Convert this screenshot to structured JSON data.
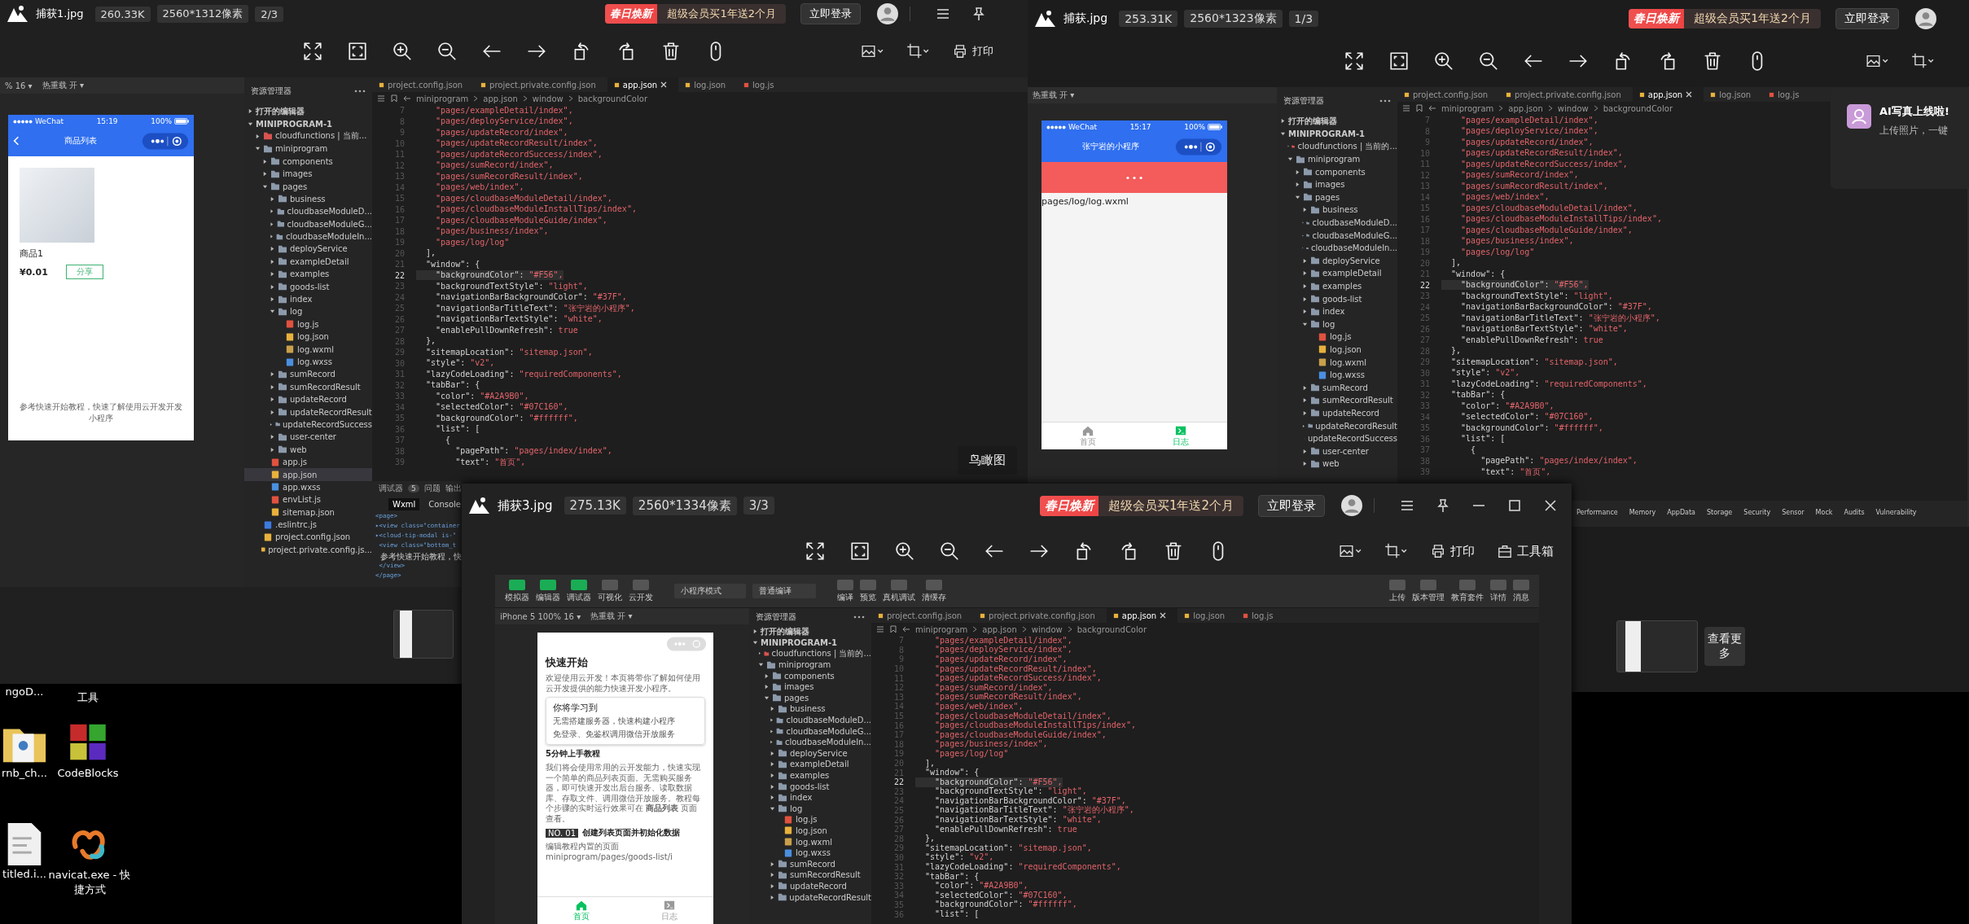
{
  "windows": [
    {
      "file_name": "捕获1.jpg",
      "file_size": "260.33K",
      "dimensions": "2560*1312像素",
      "position": "2/3",
      "promo_tag": "春日焕新",
      "promo_text": "超级会员买1年送2个月",
      "login_button": "立即登录",
      "tools_right": [
        {
          "kind": "image-edit"
        },
        {
          "kind": "crop"
        },
        {
          "kind": "print",
          "label": "打印"
        }
      ],
      "overlay_label": "鸟瞰图",
      "screenshot": {
        "sim_bar": [
          "% 16 ▾",
          "热重载 开 ▾"
        ],
        "phone": {
          "kind": "goods",
          "carrier": "WeChat",
          "time": "15:19",
          "battery": "100%",
          "title": "商品列表",
          "product_name": "商品1",
          "price": "¥0.01",
          "share_button": "分享",
          "footer": "参考快速开始教程，快速了解使用云开发开发小程序"
        },
        "explorer_title": "资源管理器",
        "tree": [
          {
            "label": "打开的编辑器",
            "kind": "section",
            "expanded": false,
            "selected": false
          },
          {
            "label": "MINIPROGRAM-1",
            "kind": "section",
            "expanded": true,
            "selected": false,
            "children": [
              {
                "label": "cloudfunctions | 当前...",
                "kind": "cloud",
                "expanded": false,
                "selected": false
              },
              {
                "label": "miniprogram",
                "kind": "folder",
                "expanded": true,
                "selected": false,
                "children": [
                  {
                    "label": "components",
                    "kind": "folder",
                    "expanded": false,
                    "selected": false
                  },
                  {
                    "label": "images",
                    "kind": "folder",
                    "expanded": false,
                    "selected": false
                  },
                  {
                    "label": "pages",
                    "kind": "folder",
                    "expanded": true,
                    "selected": false,
                    "children": [
                      {
                        "label": "business",
                        "kind": "folder",
                        "expanded": false,
                        "selected": false
                      },
                      {
                        "label": "cloudbaseModuleD...",
                        "kind": "folder",
                        "expanded": false,
                        "selected": false
                      },
                      {
                        "label": "cloudbaseModuleG...",
                        "kind": "folder",
                        "expanded": false,
                        "selected": false
                      },
                      {
                        "label": "cloudbaseModuleIn...",
                        "kind": "folder",
                        "expanded": false,
                        "selected": false
                      },
                      {
                        "label": "deployService",
                        "kind": "folder",
                        "expanded": false,
                        "selected": false
                      },
                      {
                        "label": "exampleDetail",
                        "kind": "folder",
                        "expanded": false,
                        "selected": false
                      },
                      {
                        "label": "examples",
                        "kind": "folder",
                        "expanded": false,
                        "selected": false
                      },
                      {
                        "label": "goods-list",
                        "kind": "folder",
                        "expanded": false,
                        "selected": false
                      },
                      {
                        "label": "index",
                        "kind": "folder",
                        "expanded": false,
                        "selected": false
                      },
                      {
                        "label": "log",
                        "kind": "folder",
                        "expanded": true,
                        "selected": false,
                        "children": [
                          {
                            "label": "log.js",
                            "kind": "js",
                            "selected": false
                          },
                          {
                            "label": "log.json",
                            "kind": "json",
                            "selected": false
                          },
                          {
                            "label": "log.wxml",
                            "kind": "wxml",
                            "selected": false
                          },
                          {
                            "label": "log.wxss",
                            "kind": "wxss",
                            "selected": false
                          }
                        ]
                      },
                      {
                        "label": "sumRecord",
                        "kind": "folder",
                        "expanded": false,
                        "selected": false
                      },
                      {
                        "label": "sumRecordResult",
                        "kind": "folder",
                        "expanded": false,
                        "selected": false
                      },
                      {
                        "label": "updateRecord",
                        "kind": "folder",
                        "expanded": false,
                        "selected": false
                      },
                      {
                        "label": "updateRecordResult",
                        "kind": "folder",
                        "expanded": false,
                        "selected": false
                      },
                      {
                        "label": "updateRecordSuccess",
                        "kind": "folder",
                        "expanded": false,
                        "selected": false
                      },
                      {
                        "label": "user-center",
                        "kind": "folder",
                        "expanded": false,
                        "selected": false
                      },
                      {
                        "label": "web",
                        "kind": "folder",
                        "expanded": false,
                        "selected": false
                      }
                    ]
                  },
                  {
                    "label": "app.js",
                    "kind": "js",
                    "selected": false
                  },
                  {
                    "label": "app.json",
                    "kind": "json",
                    "selected": true
                  },
                  {
                    "label": "app.wxss",
                    "kind": "wxss",
                    "selected": false
                  },
                  {
                    "label": "envList.js",
                    "kind": "js",
                    "selected": false
                  },
                  {
                    "label": "sitemap.json",
                    "kind": "json",
                    "selected": false
                  }
                ]
              },
              {
                "label": ".eslintrc.js",
                "kind": "config",
                "selected": false
              },
              {
                "label": "project.config.json",
                "kind": "json",
                "selected": false
              },
              {
                "label": "project.private.config.js...",
                "kind": "json",
                "selected": false
              }
            ]
          }
        ],
        "tabs": [
          {
            "label": "project.config.json",
            "kind": "json",
            "selected": false
          },
          {
            "label": "project.private.config.json",
            "kind": "json",
            "selected": false
          },
          {
            "label": "app.json",
            "kind": "json",
            "selected": true
          },
          {
            "label": "log.json",
            "kind": "json",
            "selected": false
          },
          {
            "label": "log.js",
            "kind": "js",
            "selected": false
          }
        ],
        "breadcrumb": [
          "miniprogram",
          "app.json",
          "window",
          "backgroundColor"
        ],
        "code": [
          {
            "n": "7",
            "val": "    \"pages/exampleDetail/index\",",
            "current": false
          },
          {
            "n": "8",
            "val": "    \"pages/deployService/index\",",
            "current": false
          },
          {
            "n": "9",
            "val": "    \"pages/updateRecord/index\",",
            "current": false
          },
          {
            "n": "10",
            "val": "    \"pages/updateRecordResult/index\",",
            "current": false
          },
          {
            "n": "11",
            "val": "    \"pages/updateRecordSuccess/index\",",
            "current": false
          },
          {
            "n": "12",
            "val": "    \"pages/sumRecord/index\",",
            "current": false
          },
          {
            "n": "13",
            "val": "    \"pages/sumRecordResult/index\",",
            "current": false
          },
          {
            "n": "14",
            "val": "    \"pages/web/index\",",
            "current": false
          },
          {
            "n": "15",
            "val": "    \"pages/cloudbaseModuleDetail/index\",",
            "current": false
          },
          {
            "n": "16",
            "val": "    \"pages/cloudbaseModuleInstallTips/index\",",
            "current": false
          },
          {
            "n": "17",
            "val": "    \"pages/cloudbaseModuleGuide/index\",",
            "current": false
          },
          {
            "n": "18",
            "val": "    \"pages/business/index\",",
            "current": false
          },
          {
            "n": "19",
            "val": "    \"pages/log/log\"",
            "current": false
          },
          {
            "n": "20",
            "key": "  ],",
            "current": false
          },
          {
            "n": "21",
            "key": "  \"window\": {",
            "current": false
          },
          {
            "n": "22",
            "key": "    \"backgroundColor\": ",
            "val": "\"#F56\",",
            "current": true
          },
          {
            "n": "23",
            "key": "    \"backgroundTextStyle\": ",
            "val": "\"light\",",
            "current": false
          },
          {
            "n": "24",
            "key": "    \"navigationBarBackgroundColor\": ",
            "val": "\"#37F\",",
            "current": false
          },
          {
            "n": "25",
            "key": "    \"navigationBarTitleText\": ",
            "val": "\"张宁岩的小程序\",",
            "current": false
          },
          {
            "n": "26",
            "key": "    \"navigationBarTextStyle\": ",
            "val": "\"white\",",
            "current": false
          },
          {
            "n": "27",
            "key": "    \"enablePullDownRefresh\": ",
            "val": "true",
            "current": false
          },
          {
            "n": "28",
            "key": "  },",
            "current": false
          },
          {
            "n": "29",
            "key": "  \"sitemapLocation\": ",
            "val": "\"sitemap.json\",",
            "current": false
          },
          {
            "n": "30",
            "key": "  \"style\": ",
            "val": "\"v2\",",
            "current": false
          },
          {
            "n": "31",
            "key": "  \"lazyCodeLoading\": ",
            "val": "\"requiredComponents\",",
            "current": false
          },
          {
            "n": "32",
            "key": "  \"tabBar\": {",
            "current": false
          },
          {
            "n": "33",
            "key": "    \"color\": ",
            "val": "\"#A2A9B0\",",
            "current": false
          },
          {
            "n": "34",
            "key": "    \"selectedColor\": ",
            "val": "\"#07C160\",",
            "current": false
          },
          {
            "n": "35",
            "key": "    \"backgroundColor\": ",
            "val": "\"#ffffff\",",
            "current": false
          },
          {
            "n": "36",
            "key": "    \"list\": [",
            "current": false
          },
          {
            "n": "37",
            "key": "      {",
            "current": false
          },
          {
            "n": "38",
            "key": "        \"pagePath\": ",
            "val": "\"pages/index/index\",",
            "current": false
          },
          {
            "n": "39",
            "key": "        \"text\": ",
            "val": "\"首页\",",
            "current": false
          }
        ],
        "debug": {
          "tabs": [
            {
              "label": "调试器",
              "badge": "5"
            },
            {
              "label": "问题"
            },
            {
              "label": "输出"
            }
          ],
          "subtabs": [
            {
              "label": "Wxml",
              "selected": true
            },
            {
              "label": "Console",
              "selected": false
            }
          ],
          "lines": [
            {
              "kind": "tag",
              "text": "<page>"
            },
            {
              "kind": "tag",
              "text": "▸<view class=\"container"
            },
            {
              "kind": "tag",
              "text": "▸<cloud-tip-modal is-\""
            },
            {
              "kind": "tag",
              "text": " <view class=\"bottom_t"
            },
            {
              "kind": "text",
              "text": "  参考快速开始教程，快"
            },
            {
              "kind": "tag",
              "text": " </view>"
            },
            {
              "kind": "tag",
              "text": "</page>"
            }
          ]
        }
      }
    },
    {
      "file_name": "捕获.jpg",
      "file_size": "253.31K",
      "dimensions": "2560*1323像素",
      "position": "1/3",
      "promo_tag": "春日焕新",
      "promo_text": "超级会员买1年送2个月",
      "login_button": "立即登录",
      "tools_right": [
        {
          "kind": "image-edit"
        },
        {
          "kind": "crop"
        }
      ],
      "notification": {
        "title": "AI写真上线啦!",
        "text": "上传照片，一键"
      },
      "more_button": "查看更多",
      "screenshot": {
        "sim_bar": [
          "热重载 开 ▾"
        ],
        "phone": {
          "kind": "log",
          "carrier": "WeChat",
          "time": "15:17",
          "battery": "100%",
          "title": "张宁岩的小程序",
          "page_path": "pages/log/log.wxml",
          "tabbar": [
            {
              "label": "首页",
              "selected": false
            },
            {
              "label": "日志",
              "selected": true
            }
          ]
        },
        "explorer_title": "资源管理器",
        "tree": [
          {
            "label": "打开的编辑器",
            "kind": "section",
            "expanded": false
          },
          {
            "label": "MINIPROGRAM-1",
            "kind": "section",
            "expanded": true,
            "children": [
              {
                "label": "cloudfunctions | 当前的...",
                "kind": "cloud",
                "expanded": false
              },
              {
                "label": "miniprogram",
                "kind": "folder",
                "expanded": true,
                "children": [
                  {
                    "label": "components",
                    "kind": "folder",
                    "expanded": false
                  },
                  {
                    "label": "images",
                    "kind": "folder",
                    "expanded": false
                  },
                  {
                    "label": "pages",
                    "kind": "folder",
                    "expanded": true,
                    "children": [
                      {
                        "label": "business",
                        "kind": "folder",
                        "expanded": false
                      },
                      {
                        "label": "cloudbaseModuleD...",
                        "kind": "folder",
                        "expanded": false
                      },
                      {
                        "label": "cloudbaseModuleG...",
                        "kind": "folder",
                        "expanded": false
                      },
                      {
                        "label": "cloudbaseModuleIn...",
                        "kind": "folder",
                        "expanded": false
                      },
                      {
                        "label": "deployService",
                        "kind": "folder",
                        "expanded": false
                      },
                      {
                        "label": "exampleDetail",
                        "kind": "folder",
                        "expanded": false
                      },
                      {
                        "label": "examples",
                        "kind": "folder",
                        "expanded": false
                      },
                      {
                        "label": "goods-list",
                        "kind": "folder",
                        "expanded": false
                      },
                      {
                        "label": "index",
                        "kind": "folder",
                        "expanded": false
                      },
                      {
                        "label": "log",
                        "kind": "folder",
                        "expanded": true,
                        "children": [
                          {
                            "label": "log.js",
                            "kind": "js"
                          },
                          {
                            "label": "log.json",
                            "kind": "json"
                          },
                          {
                            "label": "log.wxml",
                            "kind": "wxml"
                          },
                          {
                            "label": "log.wxss",
                            "kind": "wxss"
                          }
                        ]
                      },
                      {
                        "label": "sumRecord",
                        "kind": "folder",
                        "expanded": false
                      },
                      {
                        "label": "sumRecordResult",
                        "kind": "folder",
                        "expanded": false
                      },
                      {
                        "label": "updateRecord",
                        "kind": "folder",
                        "expanded": false
                      },
                      {
                        "label": "updateRecordResult",
                        "kind": "folder",
                        "expanded": false
                      },
                      {
                        "label": "updateRecordSuccess",
                        "kind": "folder",
                        "expanded": false
                      },
                      {
                        "label": "user-center",
                        "kind": "folder",
                        "expanded": false
                      },
                      {
                        "label": "web",
                        "kind": "folder",
                        "expanded": false
                      }
                    ]
                  }
                ]
              }
            ]
          }
        ],
        "tabs": [
          {
            "label": "project.config.json",
            "kind": "json",
            "selected": false
          },
          {
            "label": "project.private.config.json",
            "kind": "json",
            "selected": false
          },
          {
            "label": "app.json",
            "kind": "json",
            "selected": true
          },
          {
            "label": "log.json",
            "kind": "json",
            "selected": false
          },
          {
            "label": "log.js",
            "kind": "js",
            "selected": false
          }
        ],
        "breadcrumb": [
          "miniprogram",
          "app.json",
          "window",
          "backgroundColor"
        ],
        "code": [
          {
            "n": "7",
            "val": "    \"pages/exampleDetail/index\",",
            "current": false
          },
          {
            "n": "8",
            "val": "    \"pages/deployService/index\",",
            "current": false
          },
          {
            "n": "9",
            "val": "    \"pages/updateRecord/index\",",
            "current": false
          },
          {
            "n": "10",
            "val": "    \"pages/updateRecordResult/index\",",
            "current": false
          },
          {
            "n": "11",
            "val": "    \"pages/updateRecordSuccess/index\",",
            "current": false
          },
          {
            "n": "12",
            "val": "    \"pages/sumRecord/index\",",
            "current": false
          },
          {
            "n": "13",
            "val": "    \"pages/sumRecordResult/index\",",
            "current": false
          },
          {
            "n": "14",
            "val": "    \"pages/web/index\",",
            "current": false
          },
          {
            "n": "15",
            "val": "    \"pages/cloudbaseModuleDetail/index\",",
            "current": false
          },
          {
            "n": "16",
            "val": "    \"pages/cloudbaseModuleInstallTips/index\",",
            "current": false
          },
          {
            "n": "17",
            "val": "    \"pages/cloudbaseModuleGuide/index\",",
            "current": false
          },
          {
            "n": "18",
            "val": "    \"pages/business/index\",",
            "current": false
          },
          {
            "n": "19",
            "val": "    \"pages/log/log\"",
            "current": false
          },
          {
            "n": "20",
            "key": "  ],",
            "current": false
          },
          {
            "n": "21",
            "key": "  \"window\": {",
            "current": false
          },
          {
            "n": "22",
            "key": "    \"backgroundColor\": ",
            "val": "\"#F56\",",
            "current": true
          },
          {
            "n": "23",
            "key": "    \"backgroundTextStyle\": ",
            "val": "\"light\",",
            "current": false
          },
          {
            "n": "24",
            "key": "    \"navigationBarBackgroundColor\": ",
            "val": "\"#37F\",",
            "current": false
          },
          {
            "n": "25",
            "key": "    \"navigationBarTitleText\": ",
            "val": "\"张宁岩的小程序\",",
            "current": false
          },
          {
            "n": "26",
            "key": "    \"navigationBarTextStyle\": ",
            "val": "\"white\",",
            "current": false
          },
          {
            "n": "27",
            "key": "    \"enablePullDownRefresh\": ",
            "val": "true",
            "current": false
          },
          {
            "n": "28",
            "key": "  },",
            "current": false
          },
          {
            "n": "29",
            "key": "  \"sitemapLocation\": ",
            "val": "\"sitemap.json\",",
            "current": false
          },
          {
            "n": "30",
            "key": "  \"style\": ",
            "val": "\"v2\",",
            "current": false
          },
          {
            "n": "31",
            "key": "  \"lazyCodeLoading\": ",
            "val": "\"requiredComponents\",",
            "current": false
          },
          {
            "n": "32",
            "key": "  \"tabBar\": {",
            "current": false
          },
          {
            "n": "33",
            "key": "    \"color\": ",
            "val": "\"#A2A9B0\",",
            "current": false
          },
          {
            "n": "34",
            "key": "    \"selectedColor\": ",
            "val": "\"#07C160\",",
            "current": false
          },
          {
            "n": "35",
            "key": "    \"backgroundColor\": ",
            "val": "\"#ffffff\",",
            "current": false
          },
          {
            "n": "36",
            "key": "    \"list\": [",
            "current": false
          },
          {
            "n": "37",
            "key": "      {",
            "current": false
          },
          {
            "n": "38",
            "key": "        \"pagePath\": ",
            "val": "\"pages/index/index\",",
            "current": false
          },
          {
            "n": "39",
            "key": "        \"text\": ",
            "val": "\"首页\",",
            "current": false
          }
        ],
        "panel_tabs": [
          "Performance",
          "Memory",
          "AppData",
          "Storage",
          "Security",
          "Sensor",
          "Mock",
          "Audits",
          "Vulnerability"
        ]
      }
    },
    {
      "file_name": "捕获3.jpg",
      "file_size": "275.13K",
      "dimensions": "2560*1334像素",
      "position": "3/3",
      "promo_tag": "春日焕新",
      "promo_text": "超级会员买1年送2个月",
      "login_button": "立即登录",
      "tools_right": [
        {
          "kind": "image-edit"
        },
        {
          "kind": "crop"
        },
        {
          "kind": "print",
          "label": "打印"
        },
        {
          "kind": "toolbox",
          "label": "工具箱"
        }
      ],
      "screenshot": {
        "ide_toolbar": {
          "views": [
            {
              "label": "模拟器",
              "on": true
            },
            {
              "label": "编辑器",
              "on": true
            },
            {
              "label": "调试器",
              "on": true
            },
            {
              "label": "可视化",
              "on": false
            },
            {
              "label": "云开发",
              "on": false
            }
          ],
          "selects": [
            "小程序模式",
            "普通编译"
          ],
          "actions": [
            "编译",
            "预览",
            "真机调试",
            "清缓存"
          ],
          "right": [
            "上传",
            "版本管理",
            "教育套件",
            "详情",
            "消息"
          ]
        },
        "sim_bar": [
          "iPhone 5 100% 16 ▾",
          "热重载 开 ▾"
        ],
        "phone": {
          "kind": "quickstart",
          "heading": "快速开始",
          "intro": "欢迎使用云开发！本页将带你了解如何使用云开发提供的能力快速开发小程序。",
          "card_title": "你将学习到",
          "bullets": [
            "无需搭建服务器，快速构建小程序",
            "免登录、免鉴权调用微信开放服务"
          ],
          "section_title": "5分钟上手教程",
          "paragraph": "我们将会使用常用的云开发能力，快速实现一个简单的商品列表页面。无需购买服务器，即可快速开发出后台服务、读取数据库、存取文件、调用微信开放服务。教程每个步骤的实时运行效果可在 **商品列表** 页面查看。",
          "step_no": "NO. 01",
          "step_title": "创建列表页面并初始化数据",
          "step_text": "编辑教程内置的页面 miniprogram/pages/goods-list/i",
          "tabbar": [
            {
              "label": "首页",
              "selected": true
            },
            {
              "label": "日志",
              "selected": false
            }
          ]
        },
        "explorer_title": "资源管理器",
        "tree": [
          {
            "label": "打开的编辑器",
            "kind": "section",
            "expanded": false
          },
          {
            "label": "MINIPROGRAM-1",
            "kind": "section",
            "expanded": true,
            "children": [
              {
                "label": "cloudfunctions | 当前的...",
                "kind": "cloud",
                "expanded": false
              },
              {
                "label": "miniprogram",
                "kind": "folder",
                "expanded": true,
                "children": [
                  {
                    "label": "components",
                    "kind": "folder",
                    "expanded": false
                  },
                  {
                    "label": "images",
                    "kind": "folder",
                    "expanded": false
                  },
                  {
                    "label": "pages",
                    "kind": "folder",
                    "expanded": true,
                    "children": [
                      {
                        "label": "business",
                        "kind": "folder",
                        "expanded": false
                      },
                      {
                        "label": "cloudbaseModuleD...",
                        "kind": "folder",
                        "expanded": false
                      },
                      {
                        "label": "cloudbaseModuleG...",
                        "kind": "folder",
                        "expanded": false
                      },
                      {
                        "label": "cloudbaseModuleIn...",
                        "kind": "folder",
                        "expanded": false
                      },
                      {
                        "label": "deployService",
                        "kind": "folder",
                        "expanded": false
                      },
                      {
                        "label": "exampleDetail",
                        "kind": "folder",
                        "expanded": false
                      },
                      {
                        "label": "examples",
                        "kind": "folder",
                        "expanded": false
                      },
                      {
                        "label": "goods-list",
                        "kind": "folder",
                        "expanded": false
                      },
                      {
                        "label": "index",
                        "kind": "folder",
                        "expanded": false
                      },
                      {
                        "label": "log",
                        "kind": "folder",
                        "expanded": true,
                        "children": [
                          {
                            "label": "log.js",
                            "kind": "js"
                          },
                          {
                            "label": "log.json",
                            "kind": "json"
                          },
                          {
                            "label": "log.wxml",
                            "kind": "wxml"
                          },
                          {
                            "label": "log.wxss",
                            "kind": "wxss"
                          }
                        ]
                      },
                      {
                        "label": "sumRecord",
                        "kind": "folder",
                        "expanded": false
                      },
                      {
                        "label": "sumRecordResult",
                        "kind": "folder",
                        "expanded": false
                      },
                      {
                        "label": "updateRecord",
                        "kind": "folder",
                        "expanded": false
                      },
                      {
                        "label": "updateRecordResult",
                        "kind": "folder",
                        "expanded": false
                      }
                    ]
                  }
                ]
              }
            ]
          }
        ],
        "tabs": [
          {
            "label": "project.config.json",
            "kind": "json",
            "selected": false
          },
          {
            "label": "project.private.config.json",
            "kind": "json",
            "selected": false
          },
          {
            "label": "app.json",
            "kind": "json",
            "selected": true
          },
          {
            "label": "log.json",
            "kind": "json",
            "selected": false
          },
          {
            "label": "log.js",
            "kind": "js",
            "selected": false
          }
        ],
        "breadcrumb": [
          "miniprogram",
          "app.json",
          "window",
          "backgroundColor"
        ],
        "code": [
          {
            "n": "7",
            "val": "    \"pages/exampleDetail/index\",",
            "current": false
          },
          {
            "n": "8",
            "val": "    \"pages/deployService/index\",",
            "current": false
          },
          {
            "n": "9",
            "val": "    \"pages/updateRecord/index\",",
            "current": false
          },
          {
            "n": "10",
            "val": "    \"pages/updateRecordResult/index\",",
            "current": false
          },
          {
            "n": "11",
            "val": "    \"pages/updateRecordSuccess/index\",",
            "current": false
          },
          {
            "n": "12",
            "val": "    \"pages/sumRecord/index\",",
            "current": false
          },
          {
            "n": "13",
            "val": "    \"pages/sumRecordResult/index\",",
            "current": false
          },
          {
            "n": "14",
            "val": "    \"pages/web/index\",",
            "current": false
          },
          {
            "n": "15",
            "val": "    \"pages/cloudbaseModuleDetail/index\",",
            "current": false
          },
          {
            "n": "16",
            "val": "    \"pages/cloudbaseModuleInstallTips/index\",",
            "current": false
          },
          {
            "n": "17",
            "val": "    \"pages/cloudbaseModuleGuide/index\",",
            "current": false
          },
          {
            "n": "18",
            "val": "    \"pages/business/index\",",
            "current": false
          },
          {
            "n": "19",
            "val": "    \"pages/log/log\"",
            "current": false
          },
          {
            "n": "20",
            "key": "  ],",
            "current": false
          },
          {
            "n": "21",
            "key": "  \"window\": {",
            "current": false
          },
          {
            "n": "22",
            "key": "    \"backgroundColor\": ",
            "val": "\"#F56\",",
            "current": true
          },
          {
            "n": "23",
            "key": "    \"backgroundTextStyle\": ",
            "val": "\"light\",",
            "current": false
          },
          {
            "n": "24",
            "key": "    \"navigationBarBackgroundColor\": ",
            "val": "\"#37F\",",
            "current": false
          },
          {
            "n": "25",
            "key": "    \"navigationBarTitleText\": ",
            "val": "\"张宁岩的小程序\",",
            "current": false
          },
          {
            "n": "26",
            "key": "    \"navigationBarTextStyle\": ",
            "val": "\"white\",",
            "current": false
          },
          {
            "n": "27",
            "key": "    \"enablePullDownRefresh\": ",
            "val": "true",
            "current": false
          },
          {
            "n": "28",
            "key": "  },",
            "current": false
          },
          {
            "n": "29",
            "key": "  \"sitemapLocation\": ",
            "val": "\"sitemap.json\",",
            "current": false
          },
          {
            "n": "30",
            "key": "  \"style\": ",
            "val": "\"v2\",",
            "current": false
          },
          {
            "n": "31",
            "key": "  \"lazyCodeLoading\": ",
            "val": "\"requiredComponents\",",
            "current": false
          },
          {
            "n": "32",
            "key": "  \"tabBar\": {",
            "current": false
          },
          {
            "n": "33",
            "key": "    \"color\": ",
            "val": "\"#A2A9B0\",",
            "current": false
          },
          {
            "n": "34",
            "key": "    \"selectedColor\": ",
            "val": "\"#07C160\",",
            "current": false
          },
          {
            "n": "35",
            "key": "    \"backgroundColor\": ",
            "val": "\"#ffffff\",",
            "current": false
          },
          {
            "n": "36",
            "key": "    \"list\": [",
            "current": false
          }
        ]
      }
    }
  ],
  "desktop_icons": [
    {
      "label": "ngoD...",
      "kind": "none"
    },
    {
      "label": "工具",
      "kind": "none"
    },
    {
      "label": "rnb_ch...",
      "kind": "folder"
    },
    {
      "label": "CodeBlocks",
      "kind": "blocks"
    },
    {
      "label": "titled.i...",
      "kind": "document"
    },
    {
      "label": "navicat.exe - 快捷方式",
      "kind": "swirl"
    }
  ]
}
